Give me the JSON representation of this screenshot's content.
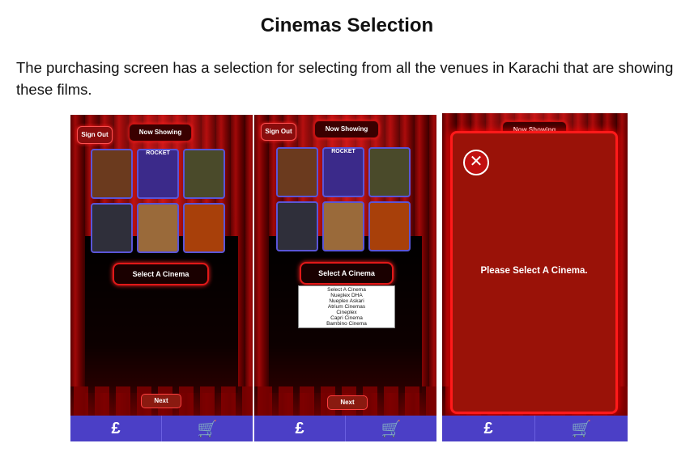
{
  "document": {
    "title": "Cinemas Selection",
    "paragraph": "The purchasing screen has a selection for selecting from all the venues in Karachi that are showing these films."
  },
  "screens": [
    {
      "sign_out": "Sign Out",
      "now_showing": "Now Showing",
      "select_button": "Select A Cinema",
      "next": "Next"
    },
    {
      "sign_out": "Sign Out",
      "now_showing": "Now Showing",
      "select_button": "Select A Cinema",
      "next": "Next",
      "dropdown_options": [
        "Select A Cinema",
        "Nueplex DHA",
        "Nueplex Askari",
        "Atrium Cinemas",
        "Cineplex",
        "Capri Cinema",
        "Bambino Cinema"
      ]
    },
    {
      "now_showing": "Now Showing",
      "modal_message": "Please Select A Cinema.",
      "close_symbol": "✕"
    }
  ],
  "posters": [
    {
      "label": "",
      "color": "#6b3a1e"
    },
    {
      "label": "ROCKET",
      "color": "#3b2a8a"
    },
    {
      "label": "",
      "color": "#4a4a2a"
    },
    {
      "label": "",
      "color": "#2f2f3a"
    },
    {
      "label": "",
      "color": "#9a6a3a"
    },
    {
      "label": "",
      "color": "#a8400a"
    }
  ],
  "nav": {
    "pound_symbol": "£",
    "cart_symbol": "🛒"
  },
  "colors": {
    "nav_bar": "#4b3fc6",
    "accent_red": "#e01818",
    "modal_bg": "#9a1208"
  }
}
